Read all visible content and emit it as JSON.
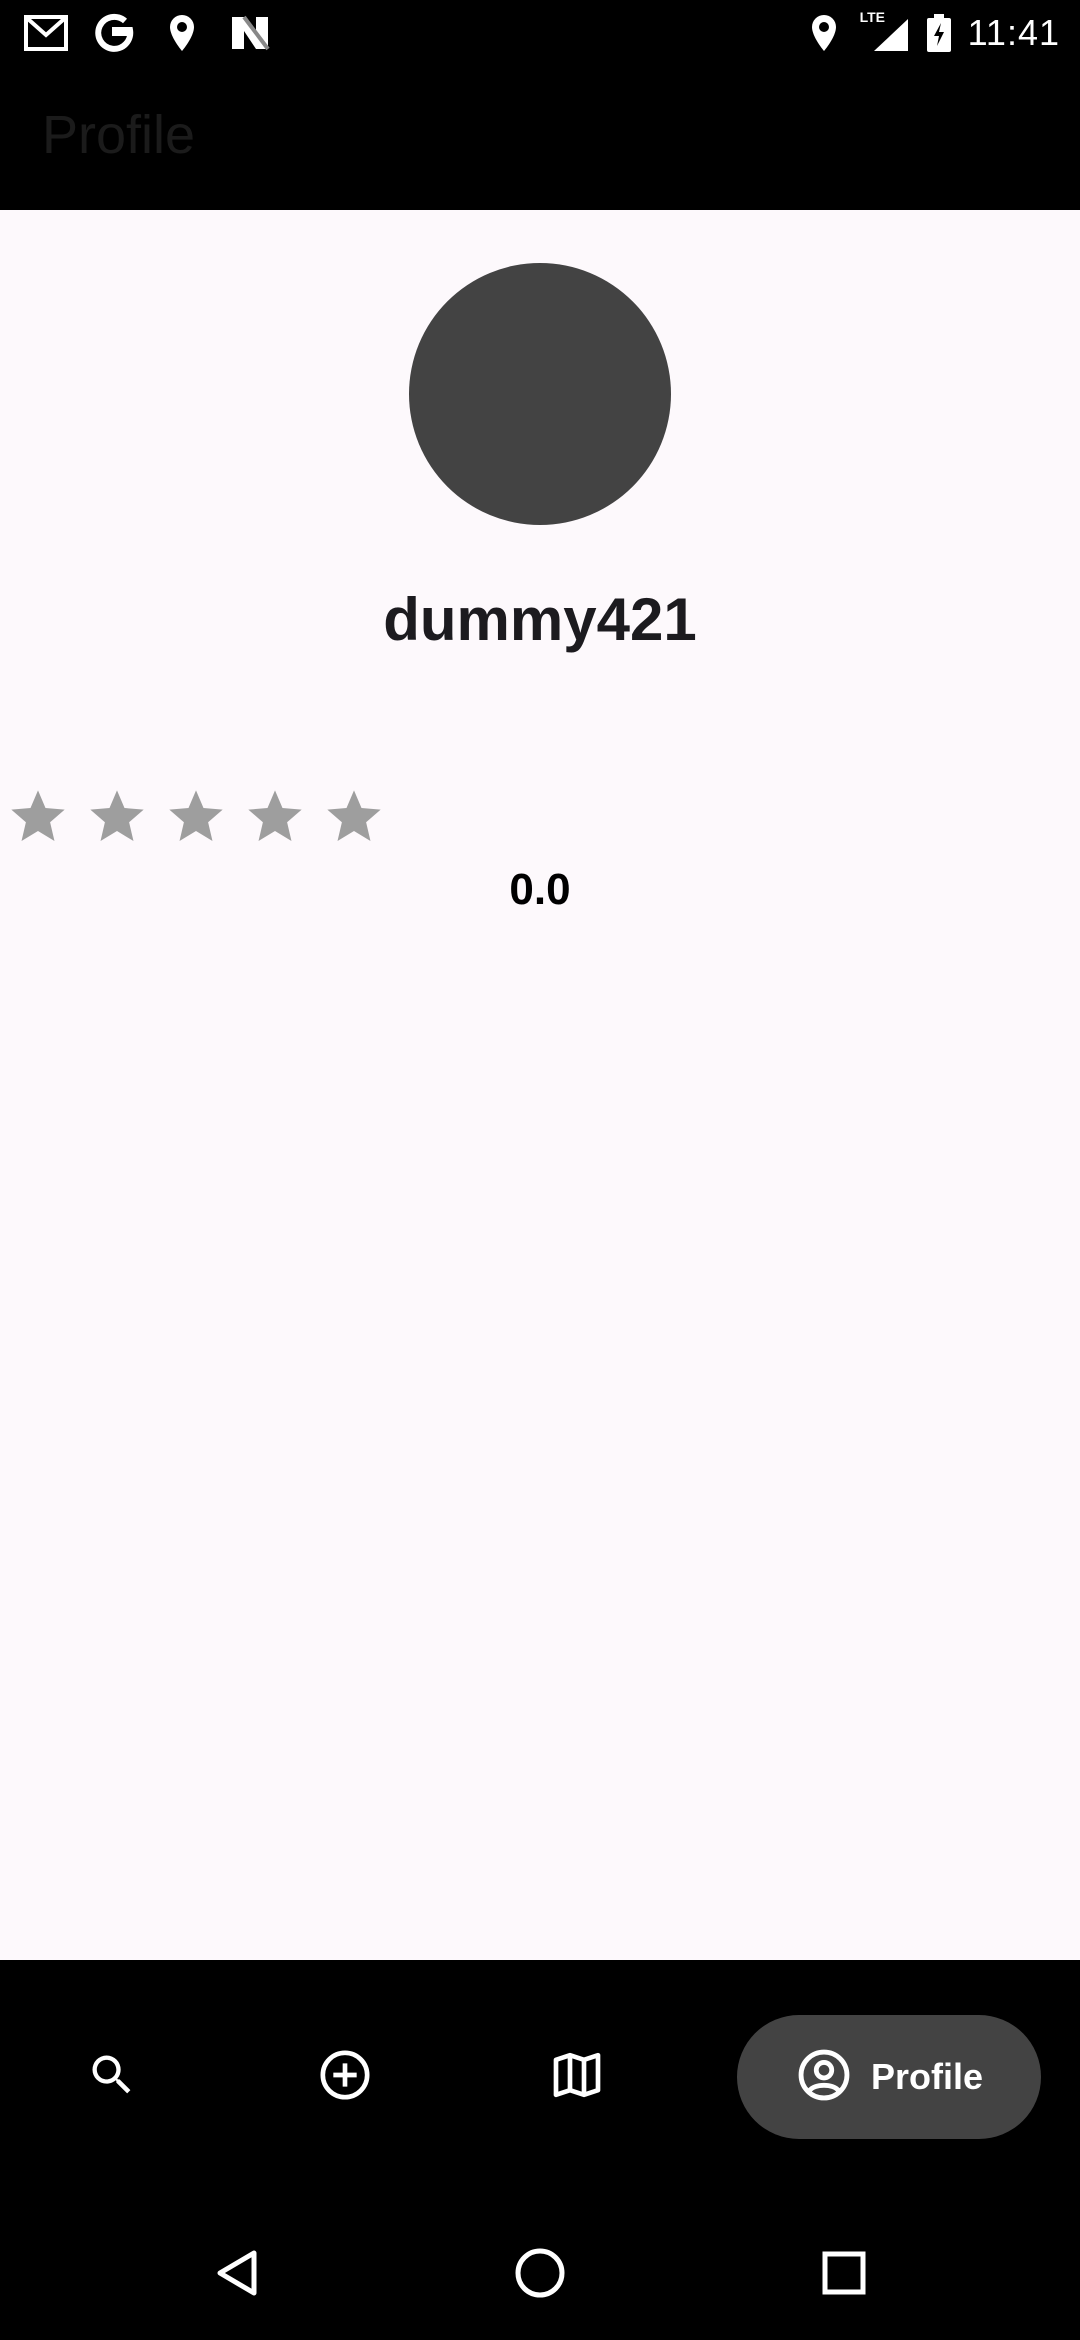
{
  "status_bar": {
    "time": "11:41",
    "left_icons": [
      "gmail-icon",
      "google-icon",
      "location-icon",
      "news-icon"
    ],
    "right_icons": [
      "location-icon",
      "lte-signal-icon",
      "battery-charging-icon"
    ],
    "network_label": "LTE"
  },
  "app_bar": {
    "title": "Profile"
  },
  "profile": {
    "username": "dummy421",
    "rating": {
      "value_text": "0.0",
      "stars_total": 5,
      "stars_filled": 0
    }
  },
  "bottom_nav": {
    "items": [
      {
        "icon": "search-icon",
        "label": ""
      },
      {
        "icon": "add-circle-icon",
        "label": ""
      },
      {
        "icon": "map-icon",
        "label": ""
      },
      {
        "icon": "account-circle-icon",
        "label": "Profile",
        "active": true
      }
    ]
  },
  "system_nav": [
    "back-icon",
    "home-icon",
    "recents-icon"
  ],
  "colors": {
    "background": "#fdf9fc",
    "bars": "#000000",
    "avatar": "#434343",
    "star": "#9e9e9e",
    "active_pill": "#434343"
  }
}
